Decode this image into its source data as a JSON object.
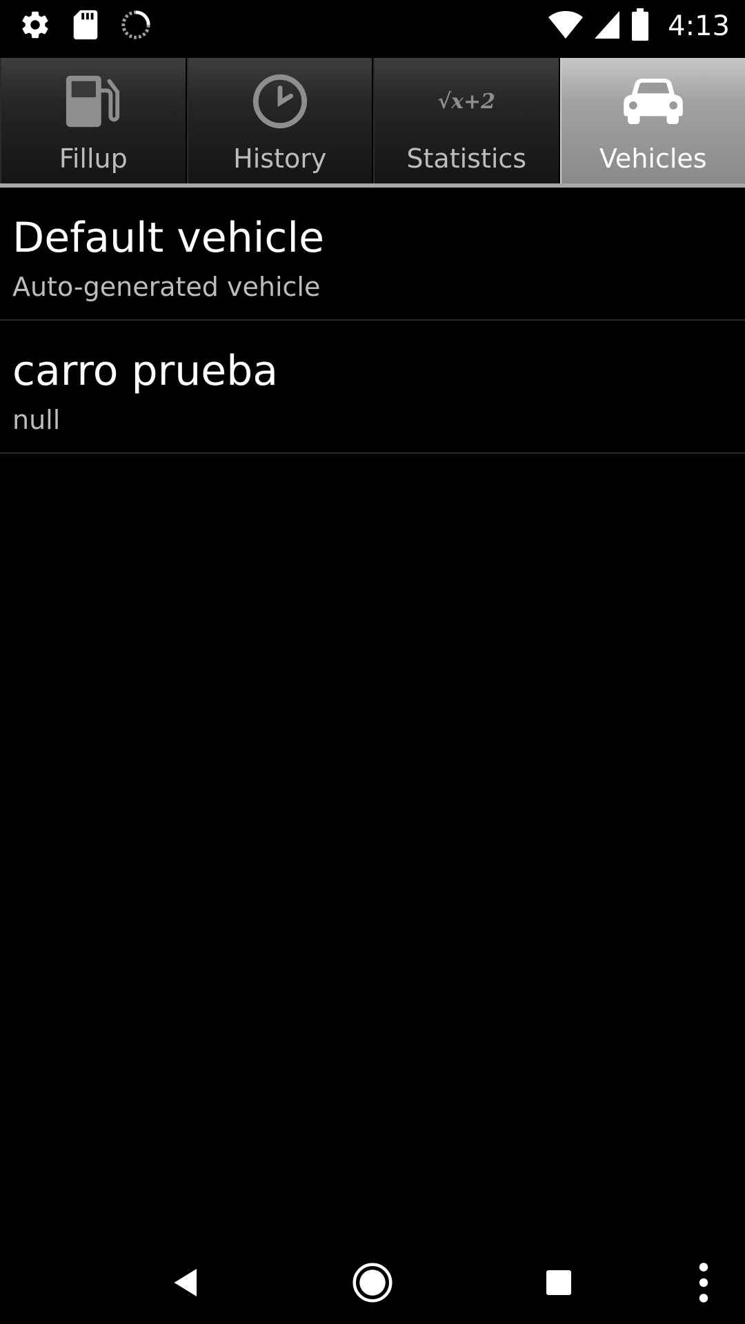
{
  "status_bar": {
    "time": "4:13",
    "left_icons": [
      "settings-icon",
      "sd-card-icon",
      "sync-icon"
    ],
    "right_icons": [
      "wifi-icon",
      "cell-signal-icon",
      "battery-icon"
    ]
  },
  "tabs": [
    {
      "label": "Fillup",
      "icon": "fuel-pump-icon",
      "selected": false
    },
    {
      "label": "History",
      "icon": "clock-icon",
      "selected": false
    },
    {
      "label": "Statistics",
      "icon": "sqrt-formula-icon",
      "icon_text": "√x+2",
      "selected": false
    },
    {
      "label": "Vehicles",
      "icon": "car-icon",
      "selected": true
    }
  ],
  "vehicles": [
    {
      "name": "Default vehicle",
      "description": "Auto-generated vehicle"
    },
    {
      "name": "carro prueba",
      "description": "null"
    }
  ],
  "nav_bar": {
    "buttons": [
      "back-icon",
      "home-icon",
      "recents-icon",
      "overflow-menu-icon"
    ]
  },
  "colors": {
    "background": "#000000",
    "tab_selected": "#a2a2a2",
    "tab_unselected": "#262626",
    "secondary_text": "#bdbdbd"
  }
}
